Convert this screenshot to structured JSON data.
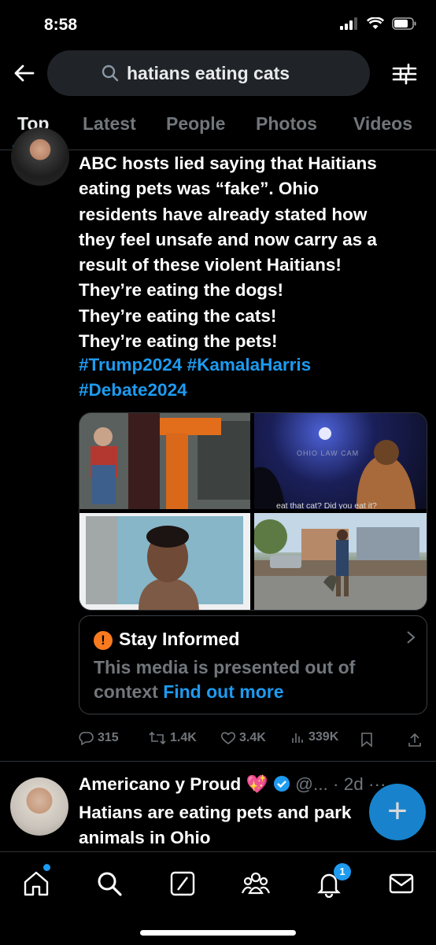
{
  "status_bar": {
    "time": "8:58"
  },
  "search": {
    "query": "hatians eating cats"
  },
  "tabs": [
    {
      "label": "Top"
    },
    {
      "label": "Latest"
    },
    {
      "label": "People"
    },
    {
      "label": "Photos"
    },
    {
      "label": "Videos"
    }
  ],
  "tweet1": {
    "text": "ABC hosts lied saying that Haitians\neating pets was “fake”. Ohio\nresidents have already stated how\nthey feel unsafe and now carry as a\nresult of these violent Haitians!\nThey’re eating the dogs!\nThey’re eating the cats!\nThey’re eating the pets!",
    "hashtags": [
      "#Trump2024",
      "#KamalaHarris",
      "#Debate2024"
    ],
    "media_caption": "eat that cat? Did you eat it?",
    "media_watermark": "OHIO LAW CAM",
    "notice": {
      "icon": "!",
      "title": "Stay Informed",
      "body": "This media is presented out of context",
      "link": "Find out more"
    },
    "stats": {
      "replies": "315",
      "retweets": "1.4K",
      "likes": "3.4K",
      "views": "339K"
    }
  },
  "tweet2": {
    "display_name": "Americano y Proud",
    "emoji": "💖",
    "handle": "@...",
    "time": "· 2d",
    "more": "···",
    "text": "Hatians are eating pets and park animals in Ohio"
  },
  "fab": {
    "label": "+"
  },
  "nav": {
    "notification_count": "1"
  },
  "colors": {
    "accent": "#1d9bf0",
    "background": "#000000",
    "notice": "#f97a1f"
  }
}
